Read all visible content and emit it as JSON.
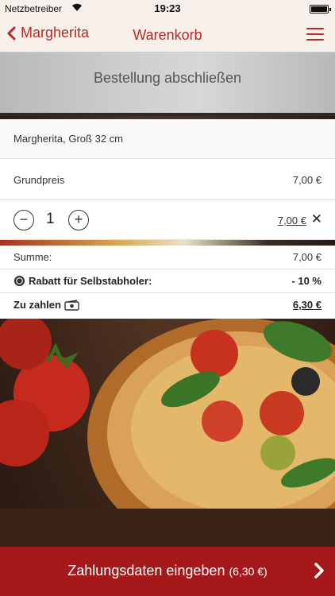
{
  "status_bar": {
    "carrier": "Netzbetreiber",
    "time": "19:23"
  },
  "navbar": {
    "back_label": "Margherita",
    "title": "Warenkorb"
  },
  "banner": {
    "label": "Bestellung abschließen"
  },
  "cart": {
    "product_name": "Margherita, Groß 32 cm",
    "base_price_label": "Grundpreis",
    "base_price_value": "7,00 €",
    "quantity": "1",
    "line_total": "7,00 €"
  },
  "summary": {
    "sum_label": "Summe:",
    "sum_value": "7,00 €",
    "discount_label": "Rabatt für Selbstabholer:",
    "discount_value": "- 10 %",
    "pay_label": "Zu zahlen",
    "pay_value": "6,30 €"
  },
  "cta": {
    "label": "Zahlungsdaten eingeben",
    "amount": "(6,30 €)"
  },
  "colors": {
    "brand_red": "#a5191b",
    "nav_bg": "#f7f0ea",
    "accent_text": "#b52a25"
  }
}
